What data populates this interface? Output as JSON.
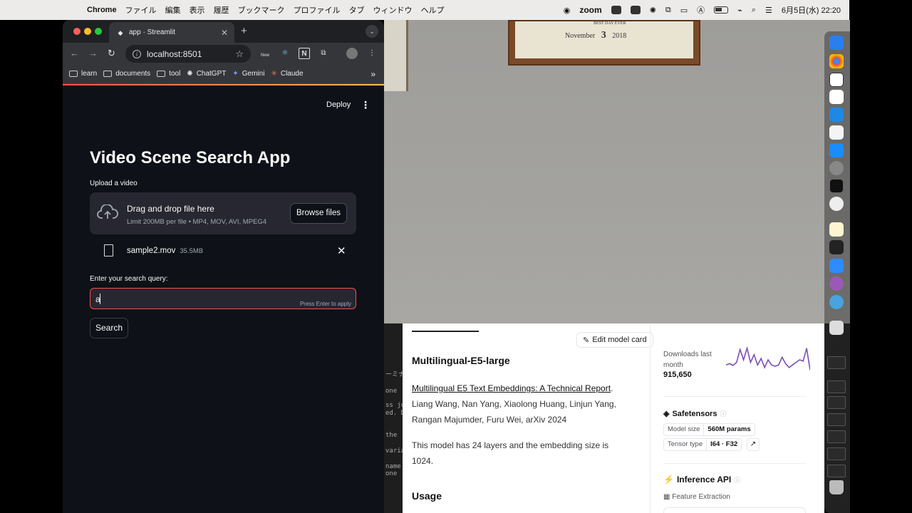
{
  "menubar": {
    "app": "Chrome",
    "items": [
      "ファイル",
      "編集",
      "表示",
      "履歴",
      "ブックマーク",
      "プロファイル",
      "タブ",
      "ウィンドウ",
      "ヘルプ"
    ],
    "zoom": "zoom",
    "clock": "6月5日(水)  22:20"
  },
  "browser": {
    "tab_title": "app · Streamlit",
    "url": "localhost:8501",
    "new_badge": "New",
    "bookmarks": [
      {
        "label": "learn",
        "icon": "folder-icon"
      },
      {
        "label": "documents",
        "icon": "folder-icon"
      },
      {
        "label": "tool",
        "icon": "folder-icon"
      },
      {
        "label": "ChatGPT",
        "icon": "chatgpt-icon"
      },
      {
        "label": "Gemini",
        "icon": "gemini-icon"
      },
      {
        "label": "Claude",
        "icon": "claude-icon"
      }
    ],
    "more_bookmarks": "»"
  },
  "streamlit": {
    "deploy": "Deploy",
    "title": "Video Scene Search App",
    "upload_label": "Upload a video",
    "drag_text": "Drag and drop file here",
    "limit_text": "Limit 200MB per file • MP4, MOV, AVI, MPEG4",
    "browse_label": "Browse files",
    "file_name": "sample2.mov",
    "file_size": "35.5MB",
    "query_label": "Enter your search query:",
    "query_value": "a",
    "query_hint": "Press Enter to apply",
    "search_label": "Search"
  },
  "photo": {
    "frame_month": "November",
    "frame_day": "3",
    "frame_year": "2018",
    "frame_header": "BEST DAY EVER"
  },
  "terminal": {
    "lines": [
      "ーミナ",
      "one",
      "ss ju",
      "ed. D",
      "the",
      "varia",
      "name",
      "one"
    ]
  },
  "huggingface": {
    "edit_label": "Edit model card",
    "model_title": "Multilingual-E5-large",
    "paper_link": "Multilingual E5 Text Embeddings: A Technical Report",
    "authors": "Liang Wang, Nan Yang, Xiaolong Huang, Linjun Yang, Rangan Majumder, Furu Wei, arXiv 2024",
    "desc": "This model has 24 layers and the embedding size is 1024.",
    "usage": "Usage",
    "downloads_label": "Downloads last month",
    "downloads_value": "915,650",
    "safetensors": "Safetensors",
    "model_size_key": "Model size",
    "model_size_val": "560M params",
    "tensor_type_key": "Tensor type",
    "tensor_type_val": "I64 · F32",
    "inference_api": "Inference API",
    "feature_extraction": "Feature Extraction",
    "downloads_trend": [
      0.3,
      0.35,
      0.28,
      0.4,
      0.9,
      0.5,
      0.95,
      0.4,
      0.7,
      0.3,
      0.55,
      0.2,
      0.5,
      0.3,
      0.25,
      0.3,
      0.6,
      0.35,
      0.2,
      0.3,
      0.4,
      0.5,
      0.45,
      0.95,
      0.1
    ]
  },
  "colors": {
    "streamlit_bg": "#0e1117",
    "streamlit_accent": "#ff4b4b",
    "hf_spark": "#7c4dbb"
  }
}
